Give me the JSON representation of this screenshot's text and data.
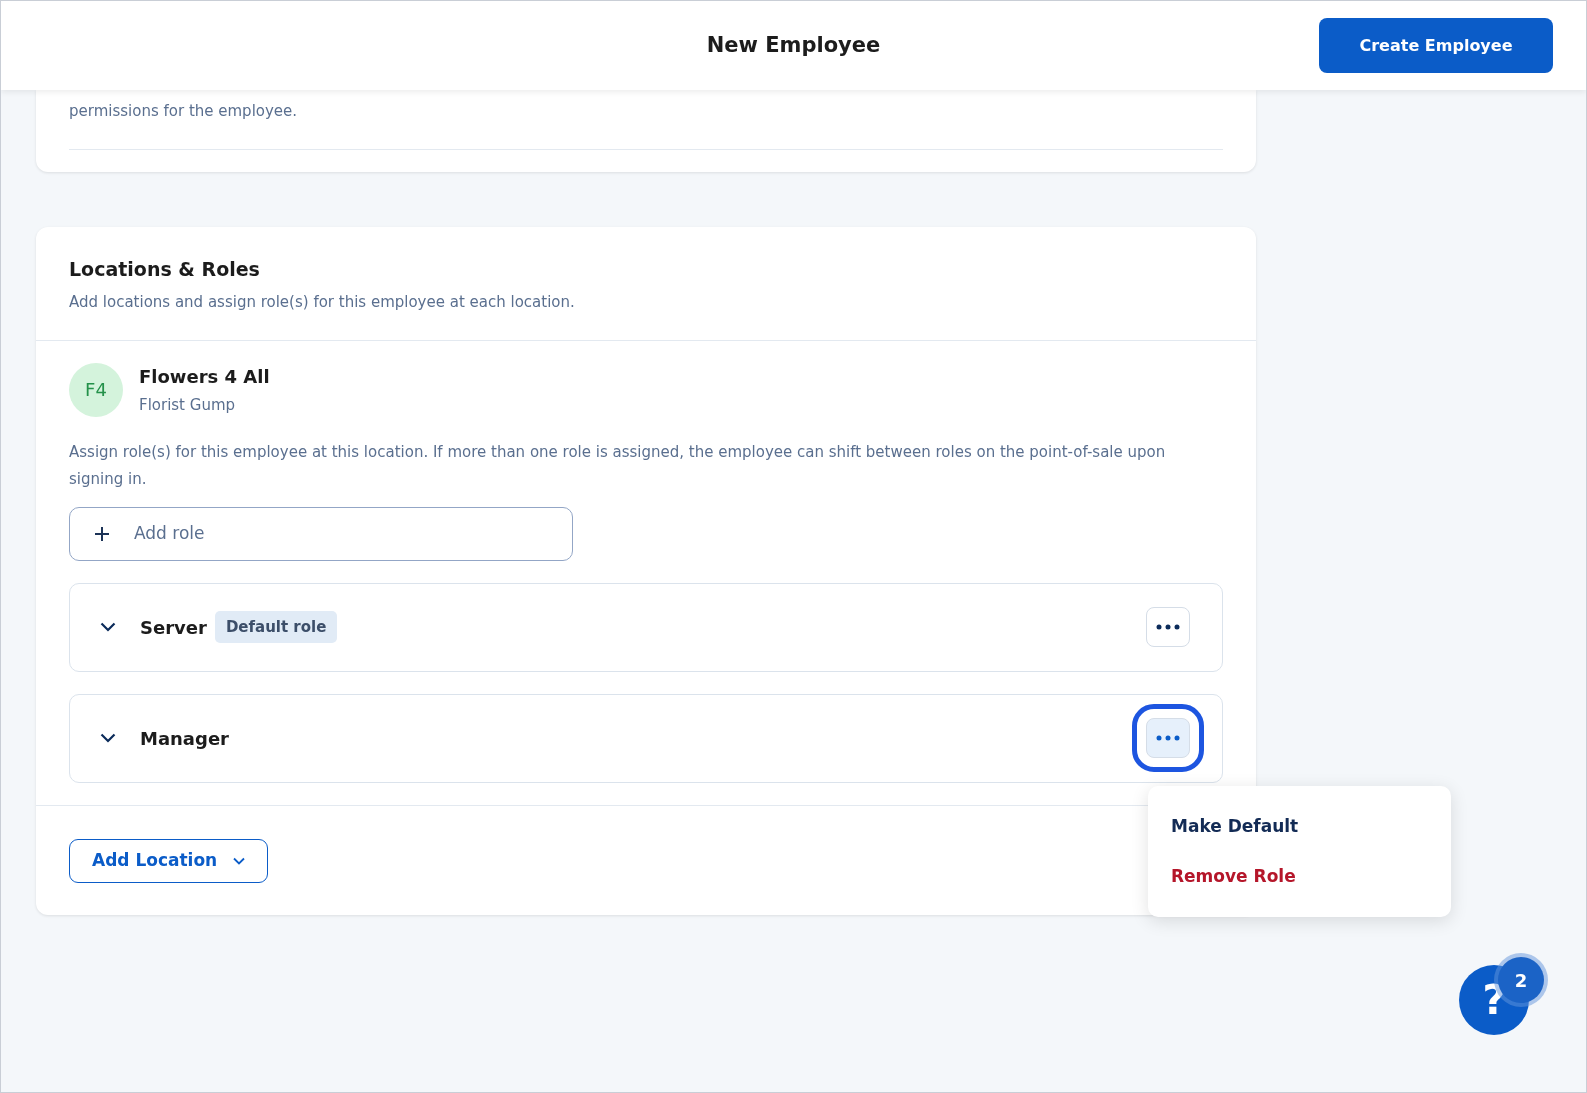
{
  "header": {
    "title": "New Employee",
    "create_button": "Create Employee"
  },
  "status_card": {
    "description_tail": "permissions for the employee."
  },
  "locations_card": {
    "title": "Locations & Roles",
    "subtitle": "Add locations and assign role(s) for this employee at each location.",
    "locations": [
      {
        "initials": "F4",
        "name": "Flowers 4 All",
        "subtitle": "Florist Gump",
        "assign_hint": "Assign role(s) for this employee at this location. If more than one role is assigned, the employee can shift between roles on the point-of-sale upon signing in.",
        "add_role": "Add role",
        "roles": [
          {
            "name": "Server",
            "badge": "Default role",
            "menu_open": false
          },
          {
            "name": "Manager",
            "menu_open": true
          }
        ]
      }
    ],
    "add_location": "Add Location"
  },
  "role_menu": {
    "items": [
      {
        "label": "Make Default",
        "kind": "normal"
      },
      {
        "label": "Remove Role",
        "kind": "danger"
      }
    ]
  },
  "help": {
    "label": "?",
    "badge": "2"
  }
}
